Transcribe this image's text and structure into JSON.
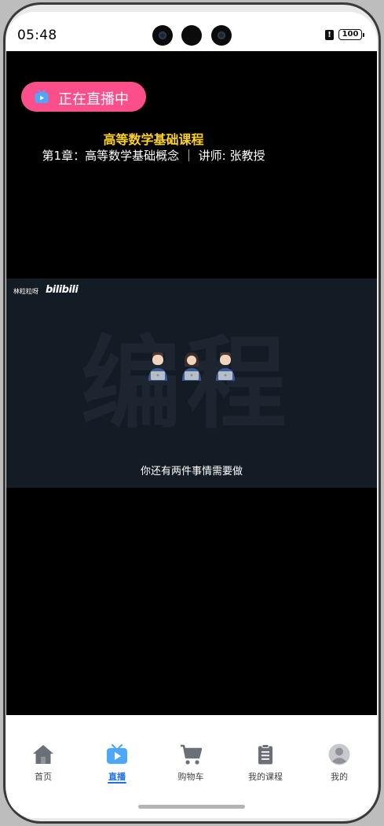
{
  "status_bar": {
    "time": "05:48",
    "battery": "100",
    "alert": "!"
  },
  "live": {
    "badge_label": "正在直播中",
    "course_title": "高等数学基础课程",
    "course_subtitle": "第1章：高等数学基础概念 ｜ 讲师: 张教授"
  },
  "player": {
    "watermark": "编程",
    "uploader": "林粒粒呀",
    "logo": "bilibili",
    "caption": "你还有两件事情需要做"
  },
  "tabbar": {
    "items": [
      {
        "label": "首页",
        "icon": "home-icon",
        "active": false
      },
      {
        "label": "直播",
        "icon": "tv-icon",
        "active": true
      },
      {
        "label": "购物车",
        "icon": "cart-icon",
        "active": false
      },
      {
        "label": "我的课程",
        "icon": "clipboard-icon",
        "active": false
      },
      {
        "label": "我的",
        "icon": "user-avatar-icon",
        "active": false
      }
    ]
  },
  "colors": {
    "live_badge": "#fb4f8c",
    "title_yellow": "#fdd21c",
    "active_tab": "#1e6fe8",
    "inactive_icon": "#6b7078",
    "player_bg": "#131b24"
  }
}
